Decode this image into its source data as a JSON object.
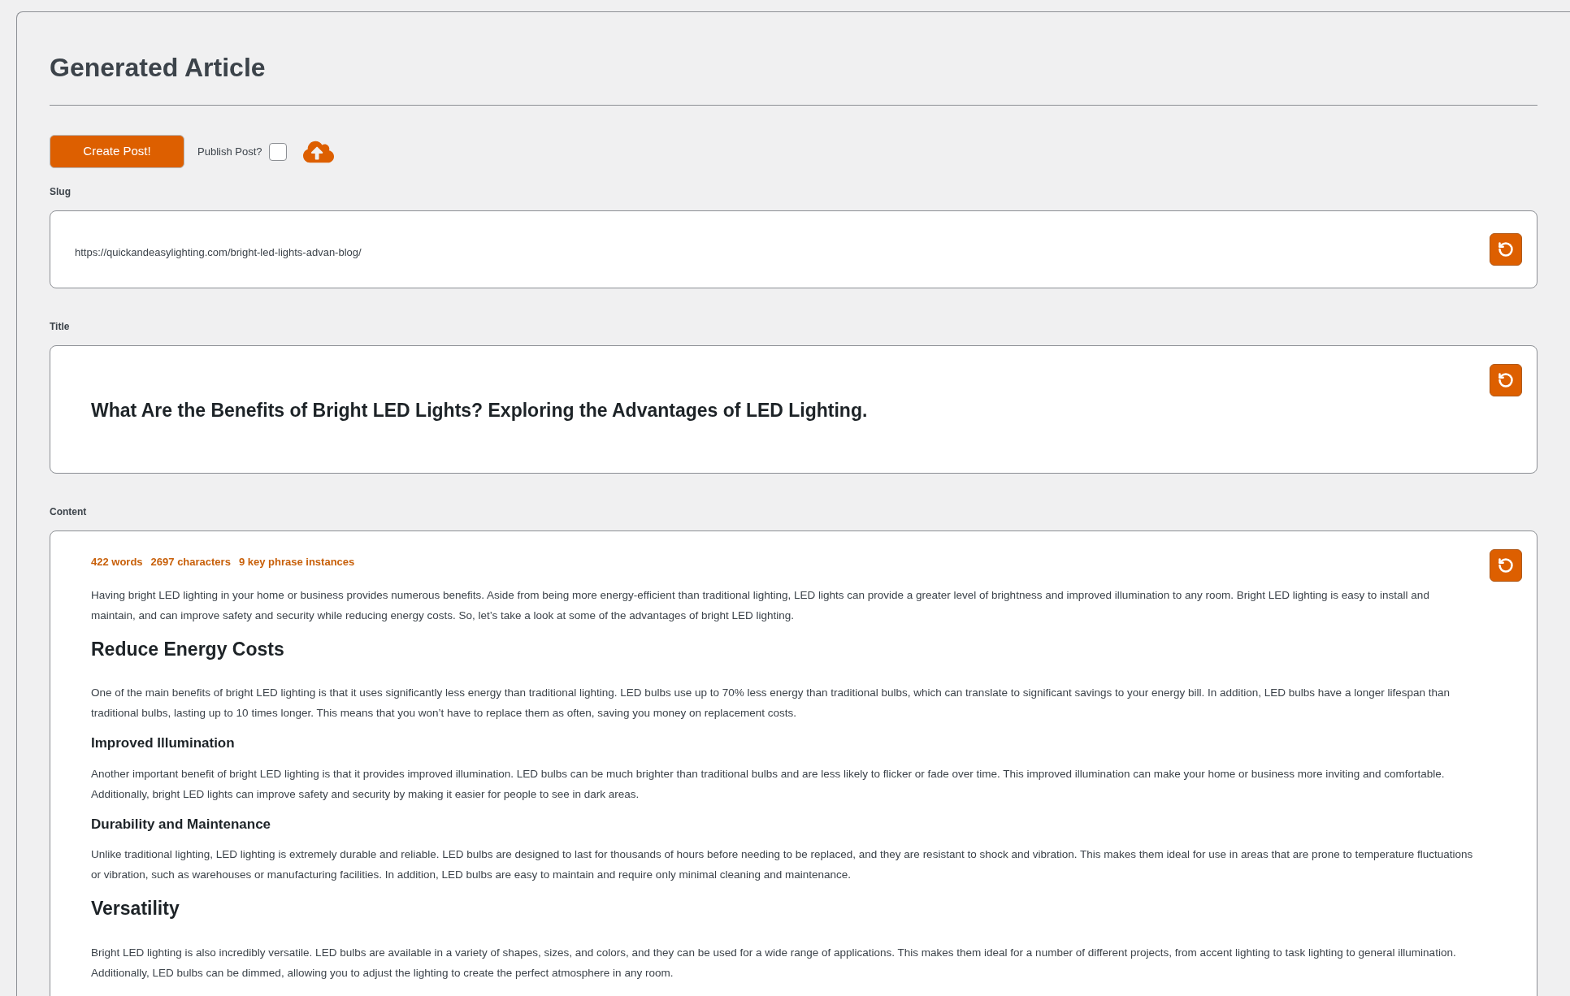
{
  "heading": "Generated Article",
  "create_button": "Create Post!",
  "publish": {
    "label": "Publish Post?",
    "checked": false
  },
  "slug": {
    "label": "Slug",
    "value": "https://quickandeasylighting.com/bright-led-lights-advan-blog/"
  },
  "title": {
    "label": "Title",
    "value": "What Are the Benefits of Bright LED Lights? Exploring the Advantages of LED Lighting."
  },
  "content": {
    "label": "Content",
    "stats": [
      "422 words",
      "2697 characters",
      "9 key phrase instances"
    ],
    "blocks": [
      {
        "kind": "paragraph",
        "text": "Having bright LED lighting in your home or business provides numerous benefits. Aside from being more energy-efficient than traditional lighting, LED lights can provide a greater level of brightness and improved illumination to any room. Bright LED lighting is easy to install and maintain, and can improve safety and security while reducing energy costs. So, let’s take a look at some of the advantages of bright LED lighting."
      },
      {
        "kind": "h2",
        "text": "Reduce Energy Costs"
      },
      {
        "kind": "paragraph",
        "text": "One of the main benefits of bright LED lighting is that it uses significantly less energy than traditional lighting. LED bulbs use up to 70% less energy than traditional bulbs, which can translate to significant savings to your energy bill. In addition, LED bulbs have a longer lifespan than traditional bulbs, lasting up to 10 times longer. This means that you won’t have to replace them as often, saving you money on replacement costs."
      },
      {
        "kind": "h3",
        "text": "Improved Illumination"
      },
      {
        "kind": "paragraph",
        "text": "Another important benefit of bright LED lighting is that it provides improved illumination. LED bulbs can be much brighter than traditional bulbs and are less likely to flicker or fade over time. This improved illumination can make your home or business more inviting and comfortable. Additionally, bright LED lights can improve safety and security by making it easier for people to see in dark areas."
      },
      {
        "kind": "h3",
        "text": "Durability and Maintenance"
      },
      {
        "kind": "paragraph",
        "text": "Unlike traditional lighting, LED lighting is extremely durable and reliable. LED bulbs are designed to last for thousands of hours before needing to be replaced, and they are resistant to shock and vibration. This makes them ideal for use in areas that are prone to temperature fluctuations or vibration, such as warehouses or manufacturing facilities. In addition, LED bulbs are easy to maintain and require only minimal cleaning and maintenance."
      },
      {
        "kind": "h2",
        "text": "Versatility"
      },
      {
        "kind": "paragraph",
        "text": "Bright LED lighting is also incredibly versatile. LED bulbs are available in a variety of shapes, sizes, and colors, and they can be used for a wide range of applications. This makes them ideal for a number of different projects, from accent lighting to task lighting to general illumination. Additionally, LED bulbs can be dimmed, allowing you to adjust the lighting to create the perfect atmosphere in any room."
      }
    ]
  }
}
